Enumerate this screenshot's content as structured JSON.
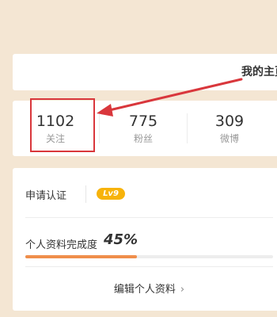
{
  "header": {
    "home_title": "我的主页"
  },
  "stats": [
    {
      "value": "1102",
      "label": "关注"
    },
    {
      "value": "775",
      "label": "粉丝"
    },
    {
      "value": "309",
      "label": "微博"
    }
  ],
  "profile": {
    "verify_label": "申请认证",
    "level_badge": "Lv9",
    "completion_label": "个人资料完成度",
    "completion_percent": "45%",
    "completion_fraction": 0.45,
    "edit_label": "编辑个人资料",
    "edit_chevron": "›"
  },
  "colors": {
    "background": "#f4e6d3",
    "highlight": "#d9373c",
    "badge": "#f7b30b",
    "progress": "#ef8e4b"
  }
}
